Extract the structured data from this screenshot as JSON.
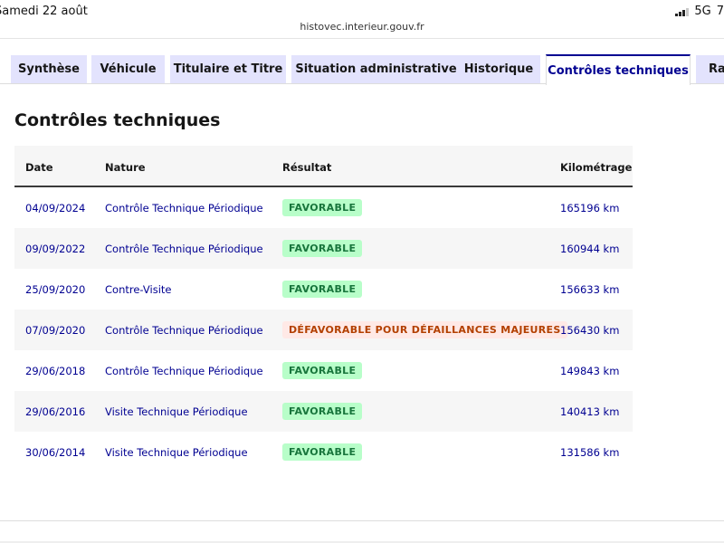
{
  "status_bar": {
    "date": "Samedi 22 août",
    "network": "5G",
    "battery": "7"
  },
  "browser": {
    "url": "histovec.interieur.gouv.fr"
  },
  "tabs": [
    {
      "label": "Synthèse",
      "active": false
    },
    {
      "label": "Véhicule",
      "active": false
    },
    {
      "label": "Titulaire et Titre",
      "active": false
    },
    {
      "label": "Situation administrative",
      "active": false
    },
    {
      "label": "Historique",
      "active": false
    },
    {
      "label": "Contrôles techniques",
      "active": true
    },
    {
      "label": "Rap",
      "active": false
    }
  ],
  "main": {
    "title": "Contrôles techniques",
    "columns": [
      "Date",
      "Nature",
      "Résultat",
      "Kilométrage"
    ],
    "rows": [
      {
        "date": "04/09/2024",
        "nature": "Contrôle Technique Périodique",
        "result": "FAVORABLE",
        "status": "ok",
        "km": "165196 km"
      },
      {
        "date": "09/09/2022",
        "nature": "Contrôle Technique Périodique",
        "result": "FAVORABLE",
        "status": "ok",
        "km": "160944 km"
      },
      {
        "date": "25/09/2020",
        "nature": "Contre-Visite",
        "result": "FAVORABLE",
        "status": "ok",
        "km": "156633 km"
      },
      {
        "date": "07/09/2020",
        "nature": "Contrôle Technique Périodique",
        "result": "DÉFAVORABLE POUR DÉFAILLANCES MAJEURES",
        "status": "ko",
        "km": "156430 km"
      },
      {
        "date": "29/06/2018",
        "nature": "Contrôle Technique Périodique",
        "result": "FAVORABLE",
        "status": "ok",
        "km": "149843 km"
      },
      {
        "date": "29/06/2016",
        "nature": "Visite Technique Périodique",
        "result": "FAVORABLE",
        "status": "ok",
        "km": "140413 km"
      },
      {
        "date": "30/06/2014",
        "nature": "Visite Technique Périodique",
        "result": "FAVORABLE",
        "status": "ok",
        "km": "131586 km"
      }
    ]
  },
  "colors": {
    "tab_background": "#e3e3fd",
    "accent_blue": "#000091",
    "badge_ok_background": "#b8fec9",
    "badge_ok_text": "#18753c",
    "badge_ko_background": "#ffe9e6",
    "badge_ko_text": "#b34000"
  }
}
